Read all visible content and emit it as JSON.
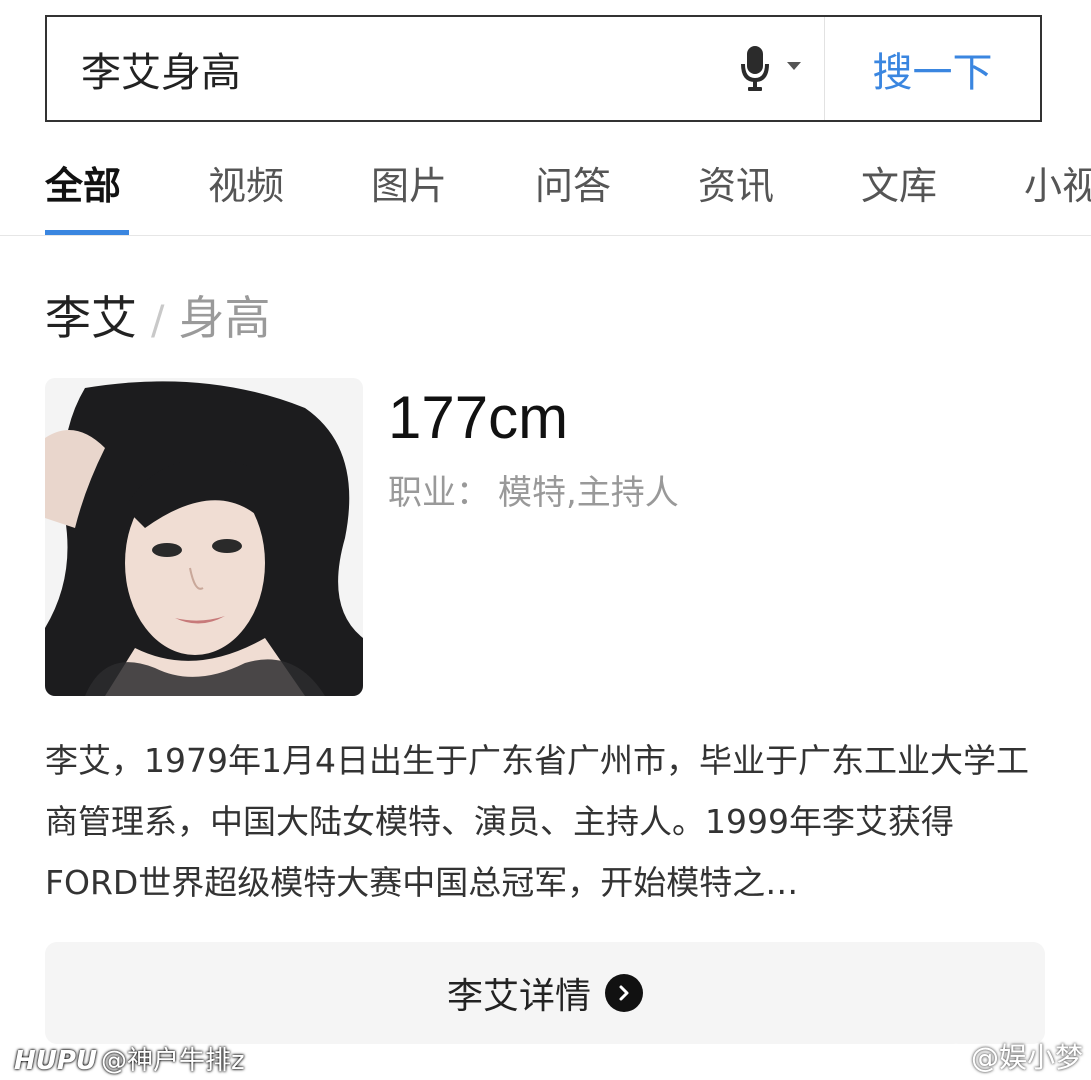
{
  "search": {
    "query": "李艾身高",
    "button_label": "搜一下"
  },
  "tabs": [
    {
      "label": "全部",
      "active": true
    },
    {
      "label": "视频"
    },
    {
      "label": "图片"
    },
    {
      "label": "问答"
    },
    {
      "label": "资讯"
    },
    {
      "label": "文库"
    },
    {
      "label": "小视"
    }
  ],
  "result": {
    "subject": "李艾",
    "separator": "/",
    "attribute": "身高",
    "value": "177cm",
    "occupation_label": "职业：",
    "occupation_value": "模特,主持人",
    "description": "李艾，1979年1月4日出生于广东省广州市，毕业于广东工业大学工商管理系，中国大陆女模特、演员、主持人。1999年李艾获得FORD世界超级模特大赛中国总冠军，开始模特之…",
    "detail_button": "李艾详情"
  },
  "watermarks": {
    "left_brand": "HUPU",
    "left_handle": "@神户牛排z",
    "right_handle": "@娱小梦"
  },
  "colors": {
    "accent": "#3a86e0"
  }
}
